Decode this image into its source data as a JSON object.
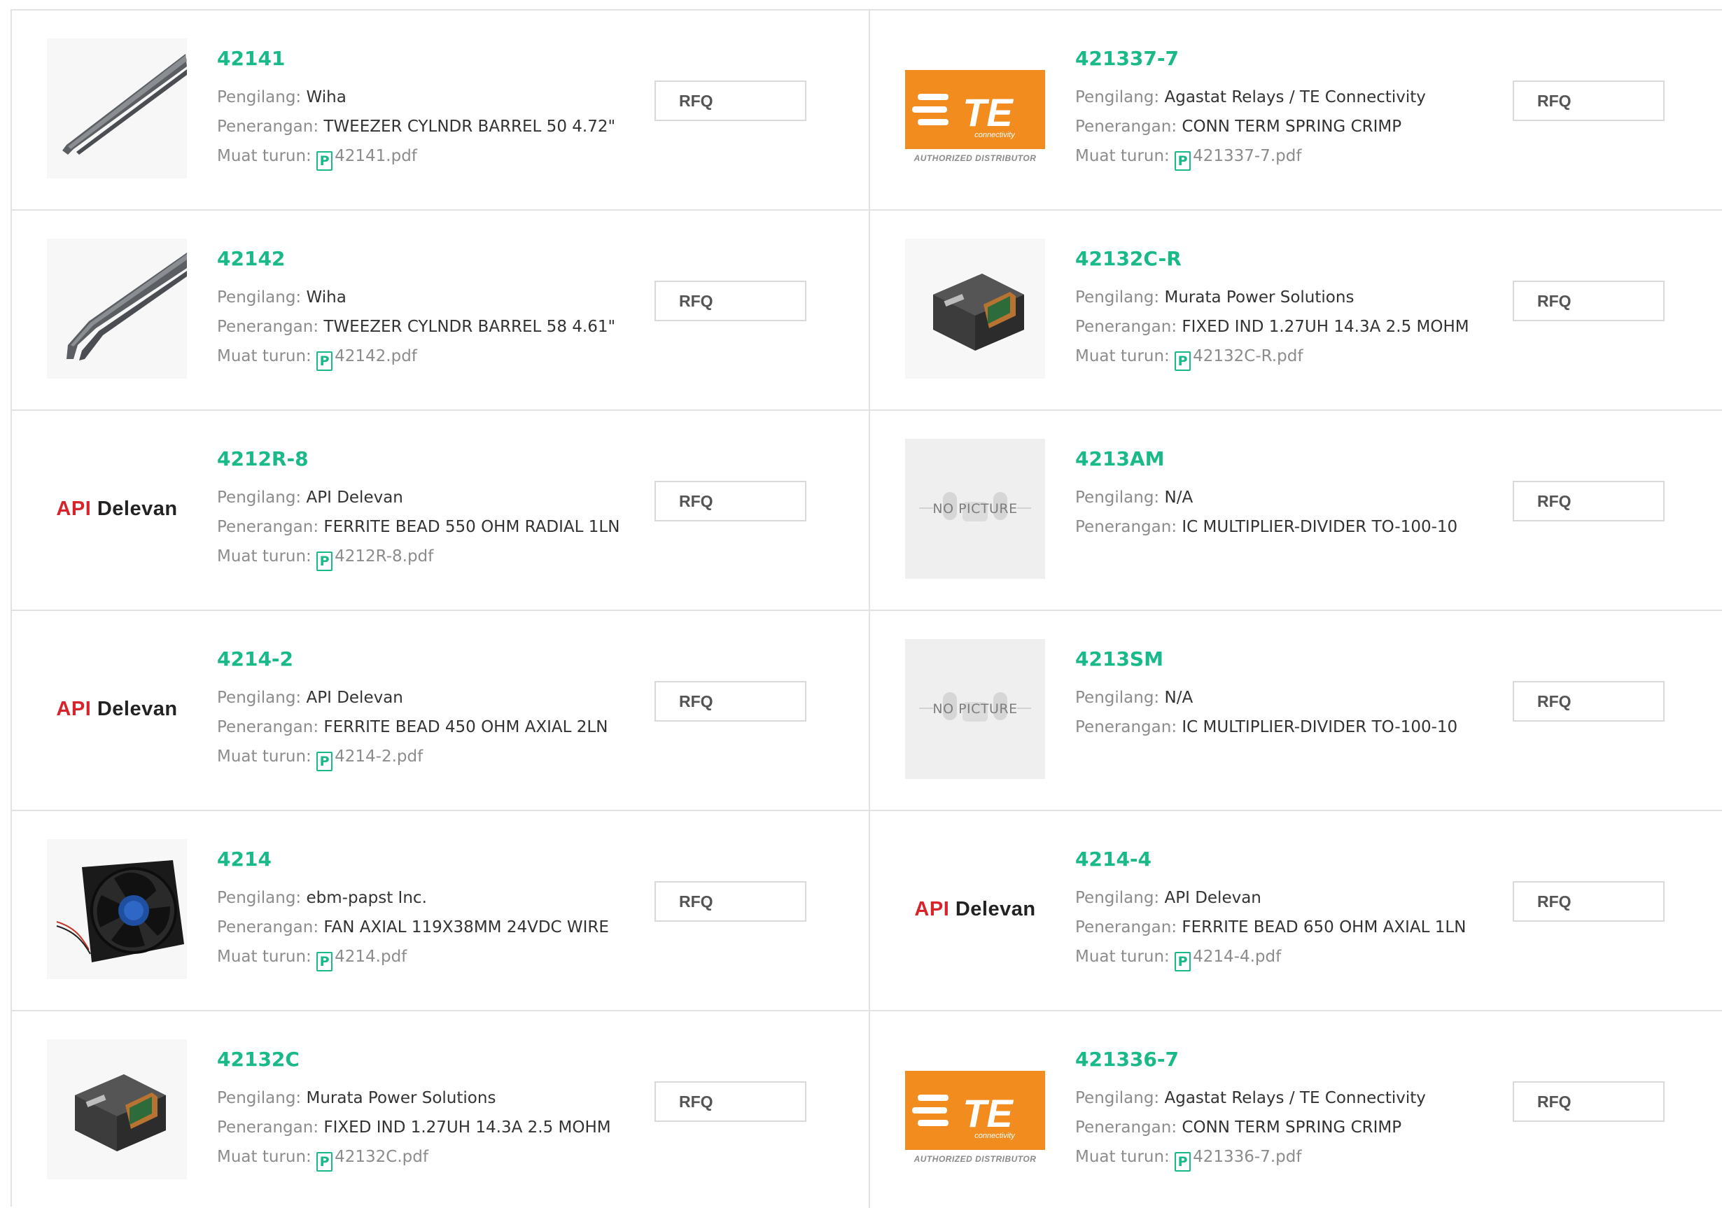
{
  "labels": {
    "manufacturer": "Pengilang:",
    "description": "Penerangan:",
    "download": "Muat turun:",
    "rfq": "RFQ",
    "no_picture": "NO PICTURE",
    "api_red": "API",
    "api_black": "Delevan",
    "te_text": "TE",
    "te_sub": "connectivity",
    "te_authorized": "AUTHORIZED DISTRIBUTOR",
    "pdf_glyph": "P"
  },
  "products": [
    {
      "part": "42141",
      "manufacturer": "Wiha",
      "description": "TWEEZER CYLNDR BARREL 50 4.72\"",
      "file": "42141.pdf",
      "image": "tweezer-straight"
    },
    {
      "part": "421337-7",
      "manufacturer": "Agastat Relays / TE Connectivity",
      "description": "CONN TERM SPRING CRIMP",
      "file": "421337-7.pdf",
      "image": "te-logo"
    },
    {
      "part": "42142",
      "manufacturer": "Wiha",
      "description": "TWEEZER CYLNDR BARREL 58 4.61\"",
      "file": "42142.pdf",
      "image": "tweezer-bent"
    },
    {
      "part": "42132C-R",
      "manufacturer": "Murata Power Solutions",
      "description": "FIXED IND 1.27UH 14.3A 2.5 MOHM",
      "file": "42132C-R.pdf",
      "image": "inductor"
    },
    {
      "part": "4212R-8",
      "manufacturer": "API Delevan",
      "description": "FERRITE BEAD 550 OHM RADIAL 1LN",
      "file": "4212R-8.pdf",
      "image": "api-delevan-logo"
    },
    {
      "part": "4213AM",
      "manufacturer": "N/A",
      "description": "IC MULTIPLIER-DIVIDER TO-100-10",
      "file": null,
      "image": "no-picture"
    },
    {
      "part": "4214-2",
      "manufacturer": "API Delevan",
      "description": "FERRITE BEAD 450 OHM AXIAL 2LN",
      "file": "4214-2.pdf",
      "image": "api-delevan-logo"
    },
    {
      "part": "4213SM",
      "manufacturer": "N/A",
      "description": "IC MULTIPLIER-DIVIDER TO-100-10",
      "file": null,
      "image": "no-picture"
    },
    {
      "part": "4214",
      "manufacturer": "ebm-papst Inc.",
      "description": "FAN AXIAL 119X38MM 24VDC WIRE",
      "file": "4214.pdf",
      "image": "fan"
    },
    {
      "part": "4214-4",
      "manufacturer": "API Delevan",
      "description": "FERRITE BEAD 650 OHM AXIAL 1LN",
      "file": "4214-4.pdf",
      "image": "api-delevan-logo"
    },
    {
      "part": "42132C",
      "manufacturer": "Murata Power Solutions",
      "description": "FIXED IND 1.27UH 14.3A 2.5 MOHM",
      "file": "42132C.pdf",
      "image": "inductor"
    },
    {
      "part": "421336-7",
      "manufacturer": "Agastat Relays / TE Connectivity",
      "description": "CONN TERM SPRING CRIMP",
      "file": "421336-7.pdf",
      "image": "te-logo"
    }
  ],
  "colors": {
    "accent": "#19b98a",
    "te_orange": "#f28c1e",
    "api_red": "#d8232a"
  }
}
